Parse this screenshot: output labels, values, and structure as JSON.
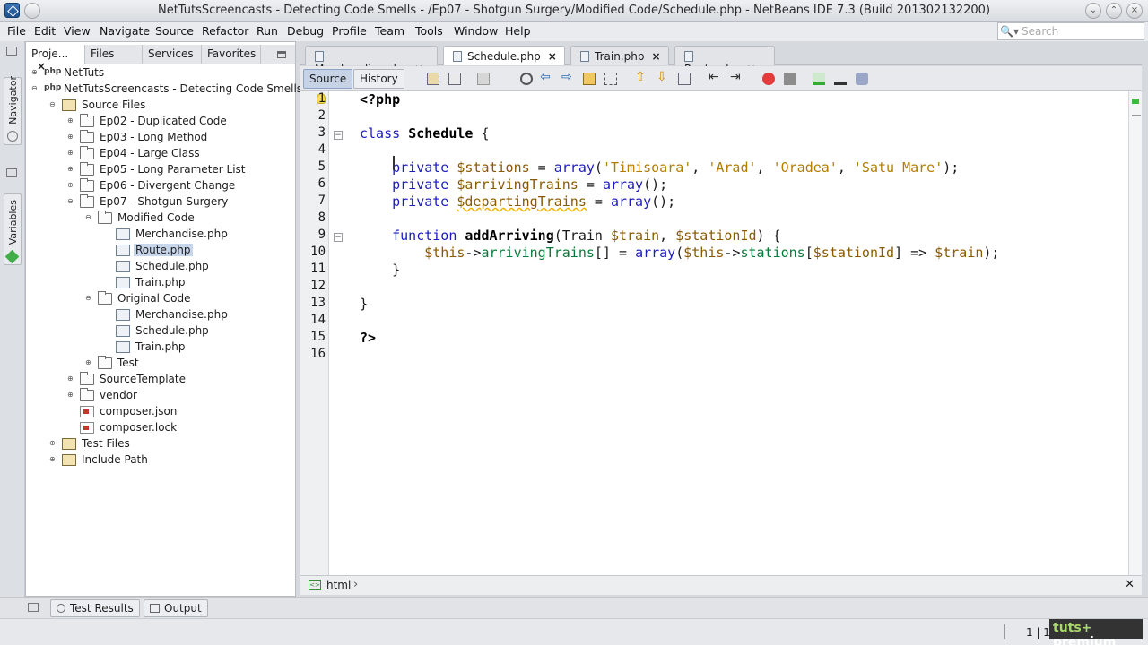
{
  "window": {
    "title": "NetTutsScreencasts - Detecting Code Smells - /Ep07 - Shotgun Surgery/Modified Code/Schedule.php - NetBeans IDE 7.3 (Build 201302132200)"
  },
  "menu": {
    "items": [
      "File",
      "Edit",
      "View",
      "Navigate",
      "Source",
      "Refactor",
      "Run",
      "Debug",
      "Profile",
      "Team",
      "Tools",
      "Window",
      "Help"
    ],
    "search_placeholder": "Search"
  },
  "left_strip": {
    "navigator": "Navigator",
    "variables": "Variables"
  },
  "project_panel": {
    "tabs": [
      "Proje...",
      "Files",
      "Services",
      "Favorites"
    ],
    "tree": [
      {
        "label": "NetTuts",
        "depth": 0,
        "icon": "php-project-icon",
        "expander": "collapsed"
      },
      {
        "label": "NetTutsScreencasts - Detecting Code Smells",
        "depth": 0,
        "icon": "php-project-icon",
        "expander": "expanded"
      },
      {
        "label": "Source Files",
        "depth": 1,
        "icon": "package-icon",
        "expander": "expanded"
      },
      {
        "label": "Ep02 - Duplicated Code",
        "depth": 2,
        "icon": "folder-icon",
        "expander": "collapsed"
      },
      {
        "label": "Ep03 - Long Method",
        "depth": 2,
        "icon": "folder-icon",
        "expander": "collapsed"
      },
      {
        "label": "Ep04 - Large Class",
        "depth": 2,
        "icon": "folder-icon",
        "expander": "collapsed"
      },
      {
        "label": "Ep05 - Long Parameter List",
        "depth": 2,
        "icon": "folder-icon",
        "expander": "collapsed"
      },
      {
        "label": "Ep06 - Divergent Change",
        "depth": 2,
        "icon": "folder-icon",
        "expander": "collapsed"
      },
      {
        "label": "Ep07 - Shotgun Surgery",
        "depth": 2,
        "icon": "folder-icon",
        "expander": "expanded"
      },
      {
        "label": "Modified Code",
        "depth": 3,
        "icon": "folder-icon",
        "expander": "expanded"
      },
      {
        "label": "Merchandise.php",
        "depth": 4,
        "icon": "php-file-icon",
        "expander": "none"
      },
      {
        "label": "Route.php",
        "depth": 4,
        "icon": "php-file-icon",
        "expander": "none",
        "selected": true
      },
      {
        "label": "Schedule.php",
        "depth": 4,
        "icon": "php-file-icon",
        "expander": "none"
      },
      {
        "label": "Train.php",
        "depth": 4,
        "icon": "php-file-icon",
        "expander": "none"
      },
      {
        "label": "Original Code",
        "depth": 3,
        "icon": "folder-icon",
        "expander": "expanded"
      },
      {
        "label": "Merchandise.php",
        "depth": 4,
        "icon": "php-file-icon",
        "expander": "none"
      },
      {
        "label": "Schedule.php",
        "depth": 4,
        "icon": "php-file-icon",
        "expander": "none"
      },
      {
        "label": "Train.php",
        "depth": 4,
        "icon": "php-file-icon",
        "expander": "none"
      },
      {
        "label": "Test",
        "depth": 3,
        "icon": "folder-icon",
        "expander": "collapsed"
      },
      {
        "label": "SourceTemplate",
        "depth": 2,
        "icon": "folder-icon",
        "expander": "collapsed"
      },
      {
        "label": "vendor",
        "depth": 2,
        "icon": "folder-icon",
        "expander": "collapsed"
      },
      {
        "label": "composer.json",
        "depth": 2,
        "icon": "json-file-icon",
        "expander": "none"
      },
      {
        "label": "composer.lock",
        "depth": 2,
        "icon": "json-file-icon",
        "expander": "none"
      },
      {
        "label": "Test Files",
        "depth": 1,
        "icon": "package-icon",
        "expander": "collapsed"
      },
      {
        "label": "Include Path",
        "depth": 1,
        "icon": "package-icon",
        "expander": "collapsed"
      }
    ]
  },
  "editor": {
    "tabs": [
      {
        "label": "Merchandise.php",
        "active": false
      },
      {
        "label": "Schedule.php",
        "active": true
      },
      {
        "label": "Train.php",
        "active": false
      },
      {
        "label": "Route.php",
        "active": false
      }
    ],
    "mode_source": "Source",
    "mode_history": "History",
    "line_numbers": [
      "1",
      "2",
      "3",
      "4",
      "5",
      "6",
      "7",
      "8",
      "9",
      "10",
      "11",
      "12",
      "13",
      "14",
      "15",
      "16"
    ],
    "code": {
      "l1": "<?php",
      "l3_kw": "class",
      "l3_name": "Schedule",
      "l3_rest": " {",
      "l5_kw": "private",
      "l5_var": "$stations",
      "l5_a": " = ",
      "l5_arr": "array",
      "l5_open": "(",
      "l5_s1": "'Timisoara'",
      "l5_s2": "'Arad'",
      "l5_s3": "'Oradea'",
      "l5_s4": "'Satu Mare'",
      "l5_sep": ", ",
      "l5_close": ");",
      "l6_kw": "private",
      "l6_var": "$arrivingTrains",
      "l6_rest": " = ",
      "l6_arr": "array",
      "l6_end": "();",
      "l7_kw": "private",
      "l7_var": "$departingTrains",
      "l7_rest": " = ",
      "l7_arr": "array",
      "l7_end": "();",
      "l9_kw": "function",
      "l9_name": "addArriving",
      "l9_a": "(Train ",
      "l9_v1": "$train",
      "l9_b": ", ",
      "l9_v2": "$stationId",
      "l9_c": ") {",
      "l10_v1": "$this",
      "l10_op1": "->",
      "l10_f1": "arrivingTrains",
      "l10_a": "[] = ",
      "l10_arr": "array",
      "l10_b": "(",
      "l10_v2": "$this",
      "l10_op2": "->",
      "l10_f2": "stations",
      "l10_c": "[",
      "l10_v3": "$stationId",
      "l10_d": "] => ",
      "l10_v4": "$train",
      "l10_e": ");",
      "l11": "}",
      "l13": "}",
      "l15": "?>"
    },
    "breadcrumb": "html"
  },
  "bottom": {
    "test_results": "Test Results",
    "output": "Output"
  },
  "status": {
    "position": "1 | 1",
    "badge_a": "tuts+",
    "badge_b": "premium"
  }
}
